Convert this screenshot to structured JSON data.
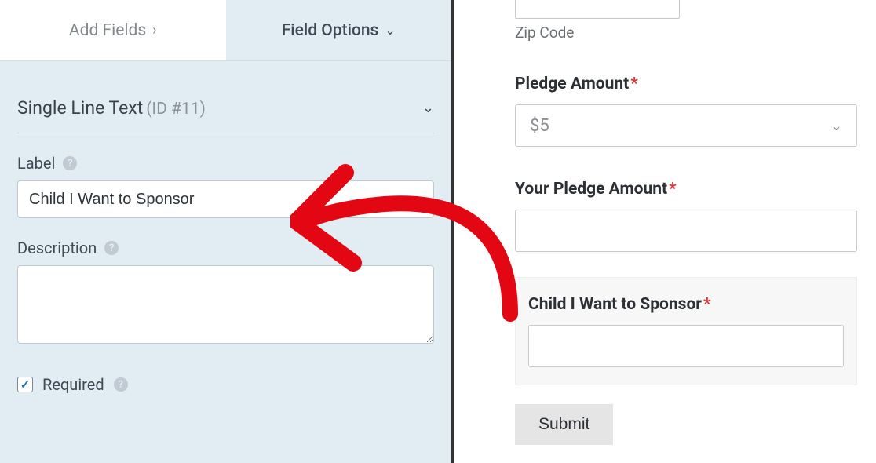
{
  "tabs": {
    "add_fields": "Add Fields",
    "field_options": "Field Options"
  },
  "field": {
    "title": "Single Line Text",
    "id_label": "(ID #11)",
    "label_heading": "Label",
    "label_value": "Child I Want to Sponsor",
    "description_heading": "Description",
    "description_value": "",
    "required_label": "Required",
    "required_checked": true
  },
  "preview": {
    "zip_label": "Zip Code",
    "pledge_label": "Pledge Amount",
    "pledge_value": "$5",
    "your_pledge_label": "Your Pledge Amount",
    "sponsor_label": "Child I Want to Sponsor",
    "submit_label": "Submit"
  },
  "glyphs": {
    "asterisk": "*",
    "check": "✓",
    "help": "?"
  }
}
